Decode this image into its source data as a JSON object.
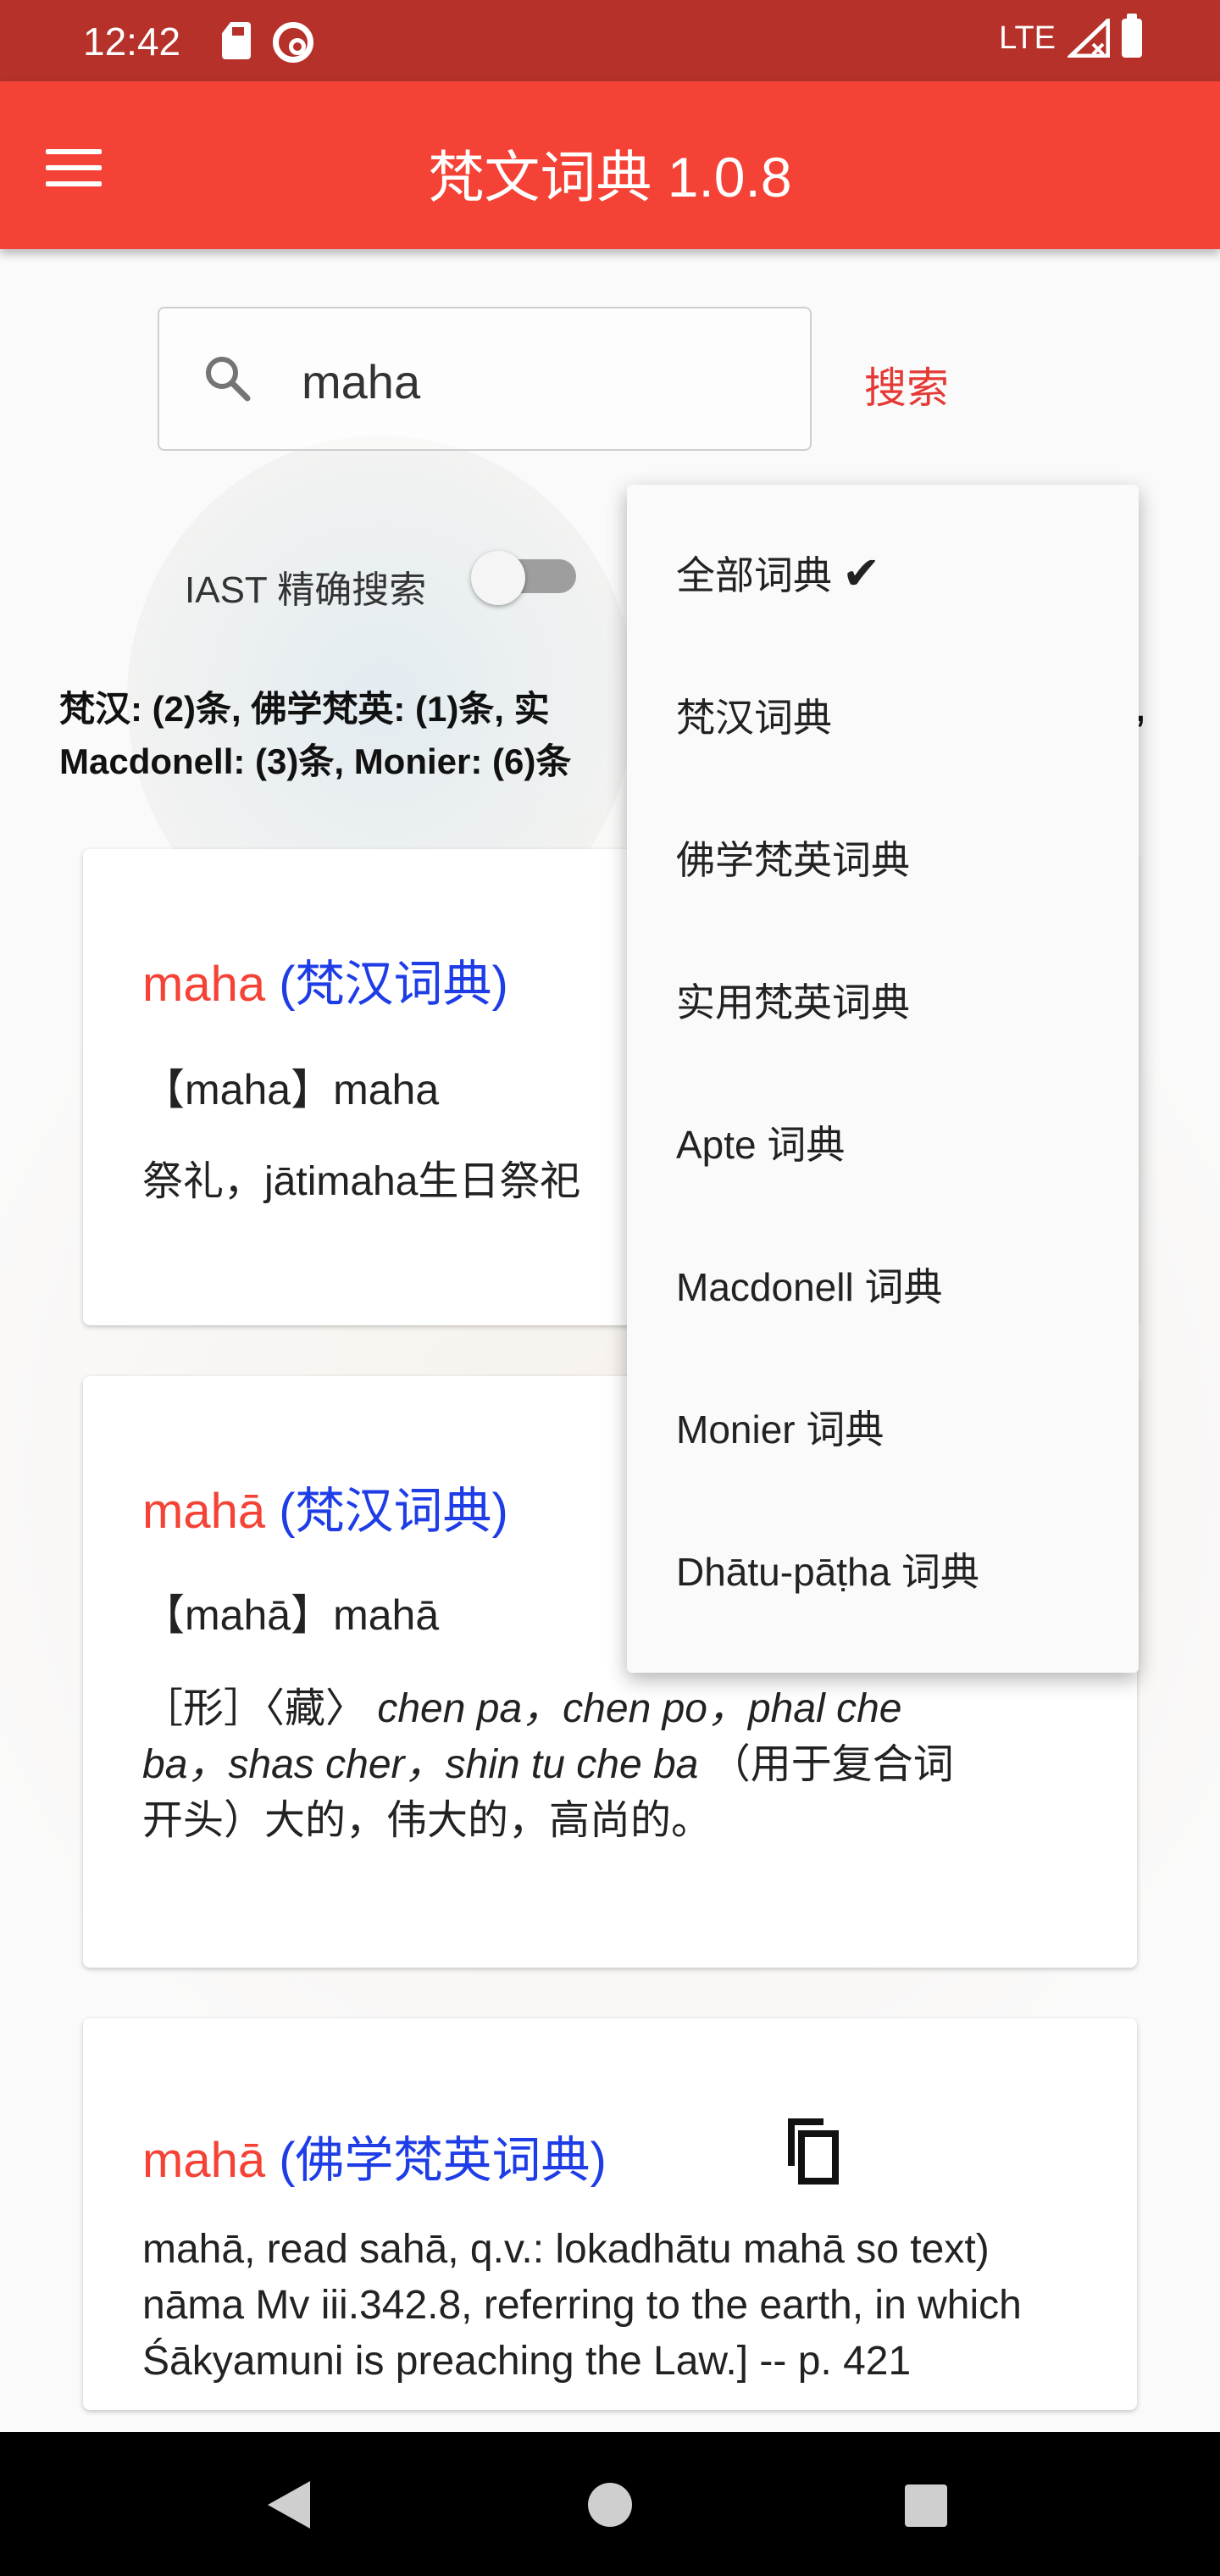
{
  "status_bar": {
    "time": "12:42",
    "network": "LTE",
    "icons": [
      "sd-card-icon",
      "at-sign-icon",
      "signal-icon",
      "battery-icon"
    ]
  },
  "app_bar": {
    "title": "梵文词典 1.0.8",
    "menu_icon": "hamburger-menu-icon"
  },
  "search": {
    "value": "maha",
    "button_label": "搜索",
    "icon": "search-icon"
  },
  "iast": {
    "label": "IAST 精确搜索",
    "enabled": false
  },
  "summary": {
    "line1": "梵汉: (2)条, 佛学梵英: (1)条, 实",
    "line2": "Macdonell: (3)条, Monier: (6)条",
    "trailing": ","
  },
  "entries": [
    {
      "word": "maha",
      "dict": "(梵汉词典)",
      "headword": "【maha】maha",
      "body": "祭礼，jātimaha生日祭祀"
    },
    {
      "word": "mahā",
      "dict": "(梵汉词典)",
      "headword": "【mahā】mahā",
      "body_line1_prefix": "［形］〈藏〉",
      "body_line1_italic": "chen pa，chen po，phal che",
      "body_line2_italic": "ba，shas cher，shin tu che ba",
      "body_line2_suffix": "（用于复合词",
      "body_line3": "开头）大的，伟大的，高尚的。"
    },
    {
      "word": "mahā",
      "dict": "(佛学梵英词典)",
      "body": "mahā, read sahā, q.v.: lokadhātu mahā so text) nāma Mv iii.342.8, referring to the earth, in which Śākyamuni is preaching the Law.] -- p. 421"
    }
  ],
  "dropdown": {
    "items": [
      {
        "label": "全部词典",
        "checked": true,
        "check_glyph": "✔"
      },
      {
        "label": "梵汉词典"
      },
      {
        "label": "佛学梵英词典"
      },
      {
        "label": "实用梵英词典"
      },
      {
        "label": "Apte 词典"
      },
      {
        "label": "Macdonell 词典"
      },
      {
        "label": "Monier 词典"
      },
      {
        "label": "Dhātu-pāṭha 词典"
      }
    ]
  },
  "colors": {
    "status_bar": "#b5312a",
    "app_bar": "#f44336",
    "entry_word": "#f44336",
    "entry_dict": "#1e3de6",
    "search_button": "#e53935"
  }
}
